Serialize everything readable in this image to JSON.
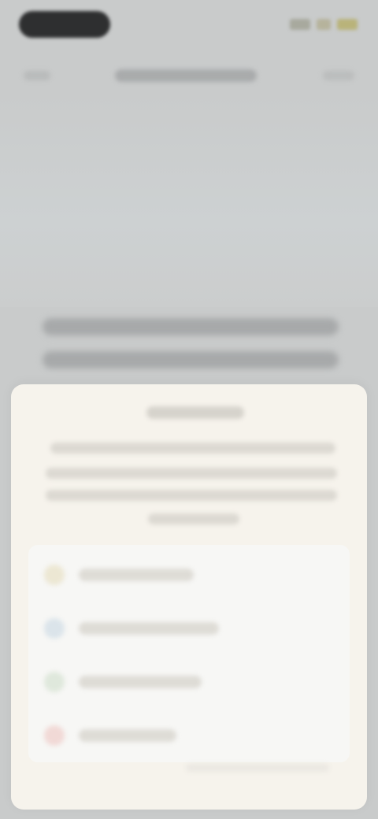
{
  "nav": {
    "back_label": "",
    "title": "",
    "action_label": ""
  },
  "content": {
    "headline_line_1": "",
    "headline_line_2": ""
  },
  "sheet": {
    "title": "",
    "description_lines": [
      "",
      "",
      "",
      ""
    ],
    "options": [
      {
        "label": "",
        "icon": "circle-icon",
        "color": "#ece7d3"
      },
      {
        "label": "",
        "icon": "circle-icon",
        "color": "#dbe4ea"
      },
      {
        "label": "",
        "icon": "circle-icon",
        "color": "#dfe8dc"
      },
      {
        "label": "",
        "icon": "circle-icon",
        "color": "#f1d9d6"
      }
    ],
    "footer_note": ""
  },
  "colors": {
    "background": "#c9cbcb",
    "sheet": "#f6f3ec",
    "options_panel": "#f7f7f5"
  }
}
